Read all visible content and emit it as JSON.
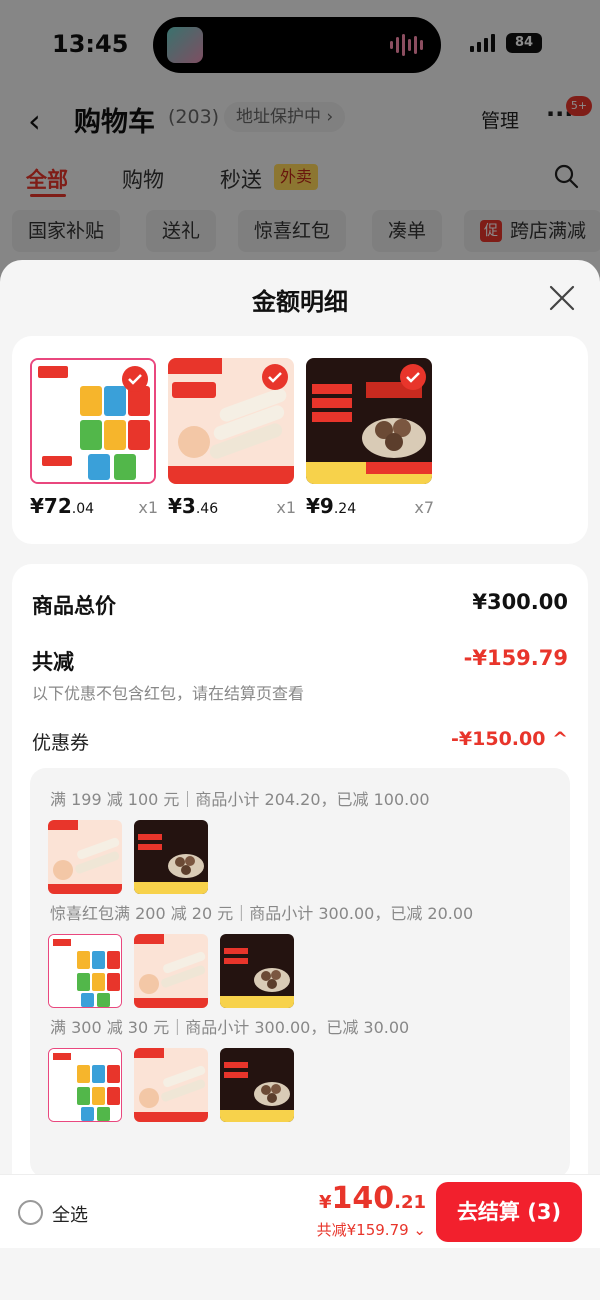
{
  "status_bar": {
    "time": "13:45",
    "battery": "84"
  },
  "nav": {
    "title": "购物车",
    "count": "(203)",
    "address_pill": "地址保护中 ›",
    "manage": "管理",
    "badge": "5+"
  },
  "tabs": [
    {
      "label": "全部",
      "active": true
    },
    {
      "label": "购物"
    },
    {
      "label": "秒送"
    }
  ],
  "tab_tag": "外卖",
  "chips": [
    "国家补贴",
    "送礼",
    "惊喜红包",
    "凑单",
    "跨店满减"
  ],
  "chip_promo_tag": "促",
  "sheet": {
    "title": "金额明细"
  },
  "products": [
    {
      "price_main": "¥72",
      "price_decimal": ".04",
      "qty": "x1",
      "image": "nissin-cup-noodles"
    },
    {
      "price_main": "¥3",
      "price_decimal": ".46",
      "qty": "x1",
      "image": "fish-sausage"
    },
    {
      "price_main": "¥9",
      "price_decimal": ".24",
      "qty": "x7",
      "image": "beef-balls"
    }
  ],
  "summary": {
    "total_label": "商品总价",
    "total_value": "¥300.00",
    "reduce_label": "共减",
    "reduce_value": "-¥159.79",
    "note": "以下优惠不包含红包，请在结算页查看",
    "coupon_label": "优惠券",
    "coupon_value": "-¥150.00 ^"
  },
  "coupon_groups": [
    {
      "text": "满 199 减 100 元｜商品小计 204.20，已减 100.00",
      "items": [
        "fish-sausage",
        "beef-balls"
      ]
    },
    {
      "text": "惊喜红包满 200 减 20 元｜商品小计 300.00，已减 20.00",
      "items": [
        "nissin-cup-noodles",
        "fish-sausage",
        "beef-balls"
      ]
    },
    {
      "text": "满 300 减 30 元｜商品小计 300.00，已减 30.00",
      "items": [
        "nissin-cup-noodles",
        "fish-sausage",
        "beef-balls"
      ]
    }
  ],
  "bottom_bar": {
    "select_all": "全选",
    "total_yen": "¥",
    "total_main": "140",
    "total_decimal": ".21",
    "saved": "共减¥159.79 ⌄",
    "checkout": "去结算 (3)"
  },
  "colors": {
    "accent": "#e8352b",
    "button": "#f2202d"
  }
}
